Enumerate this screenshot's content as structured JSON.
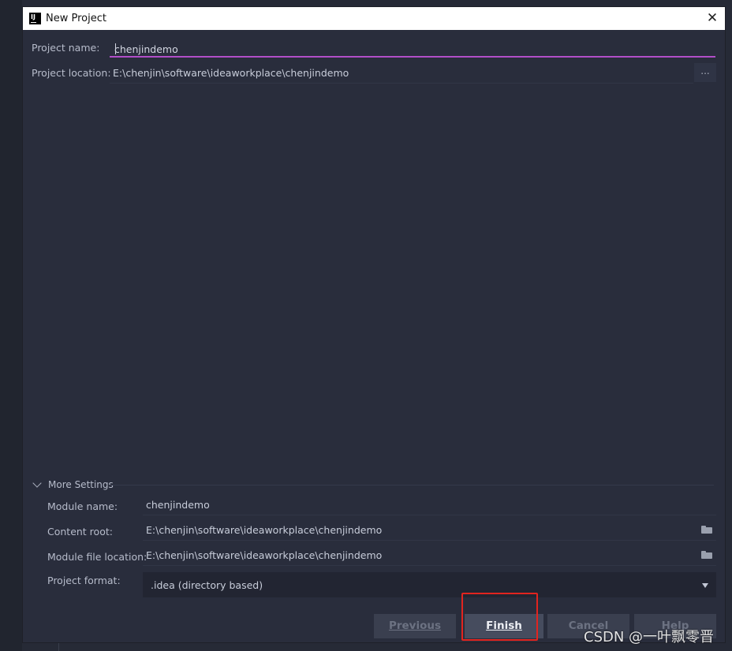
{
  "window": {
    "title": "New Project",
    "close_glyph": "✕",
    "icon": "intellij-icon",
    "icon_text": "IJ"
  },
  "project_name": {
    "label": "Project name:",
    "value": "chenjindemo"
  },
  "project_location": {
    "label": "Project location:",
    "value": "E:\\chenjin\\software\\ideaworkplace\\chenjindemo",
    "browse_label": "..."
  },
  "more_settings": {
    "label": "More Settings",
    "module_name": {
      "label": "Module name:",
      "value": "chenjindemo"
    },
    "content_root": {
      "label": "Content root:",
      "value": "E:\\chenjin\\software\\ideaworkplace\\chenjindemo"
    },
    "module_file_location": {
      "label": "Module file location:",
      "value": "E:\\chenjin\\software\\ideaworkplace\\chenjindemo"
    },
    "project_format": {
      "label": "Project format:",
      "selected": ".idea (directory based)"
    }
  },
  "buttons": {
    "previous": "Previous",
    "finish": "Finish",
    "cancel": "Cancel",
    "help": "Help"
  },
  "colors": {
    "accent": "#b24ec9",
    "highlight": "#e2241f",
    "background": "#292d3c"
  },
  "watermark": "CSDN @一叶飘零晋"
}
